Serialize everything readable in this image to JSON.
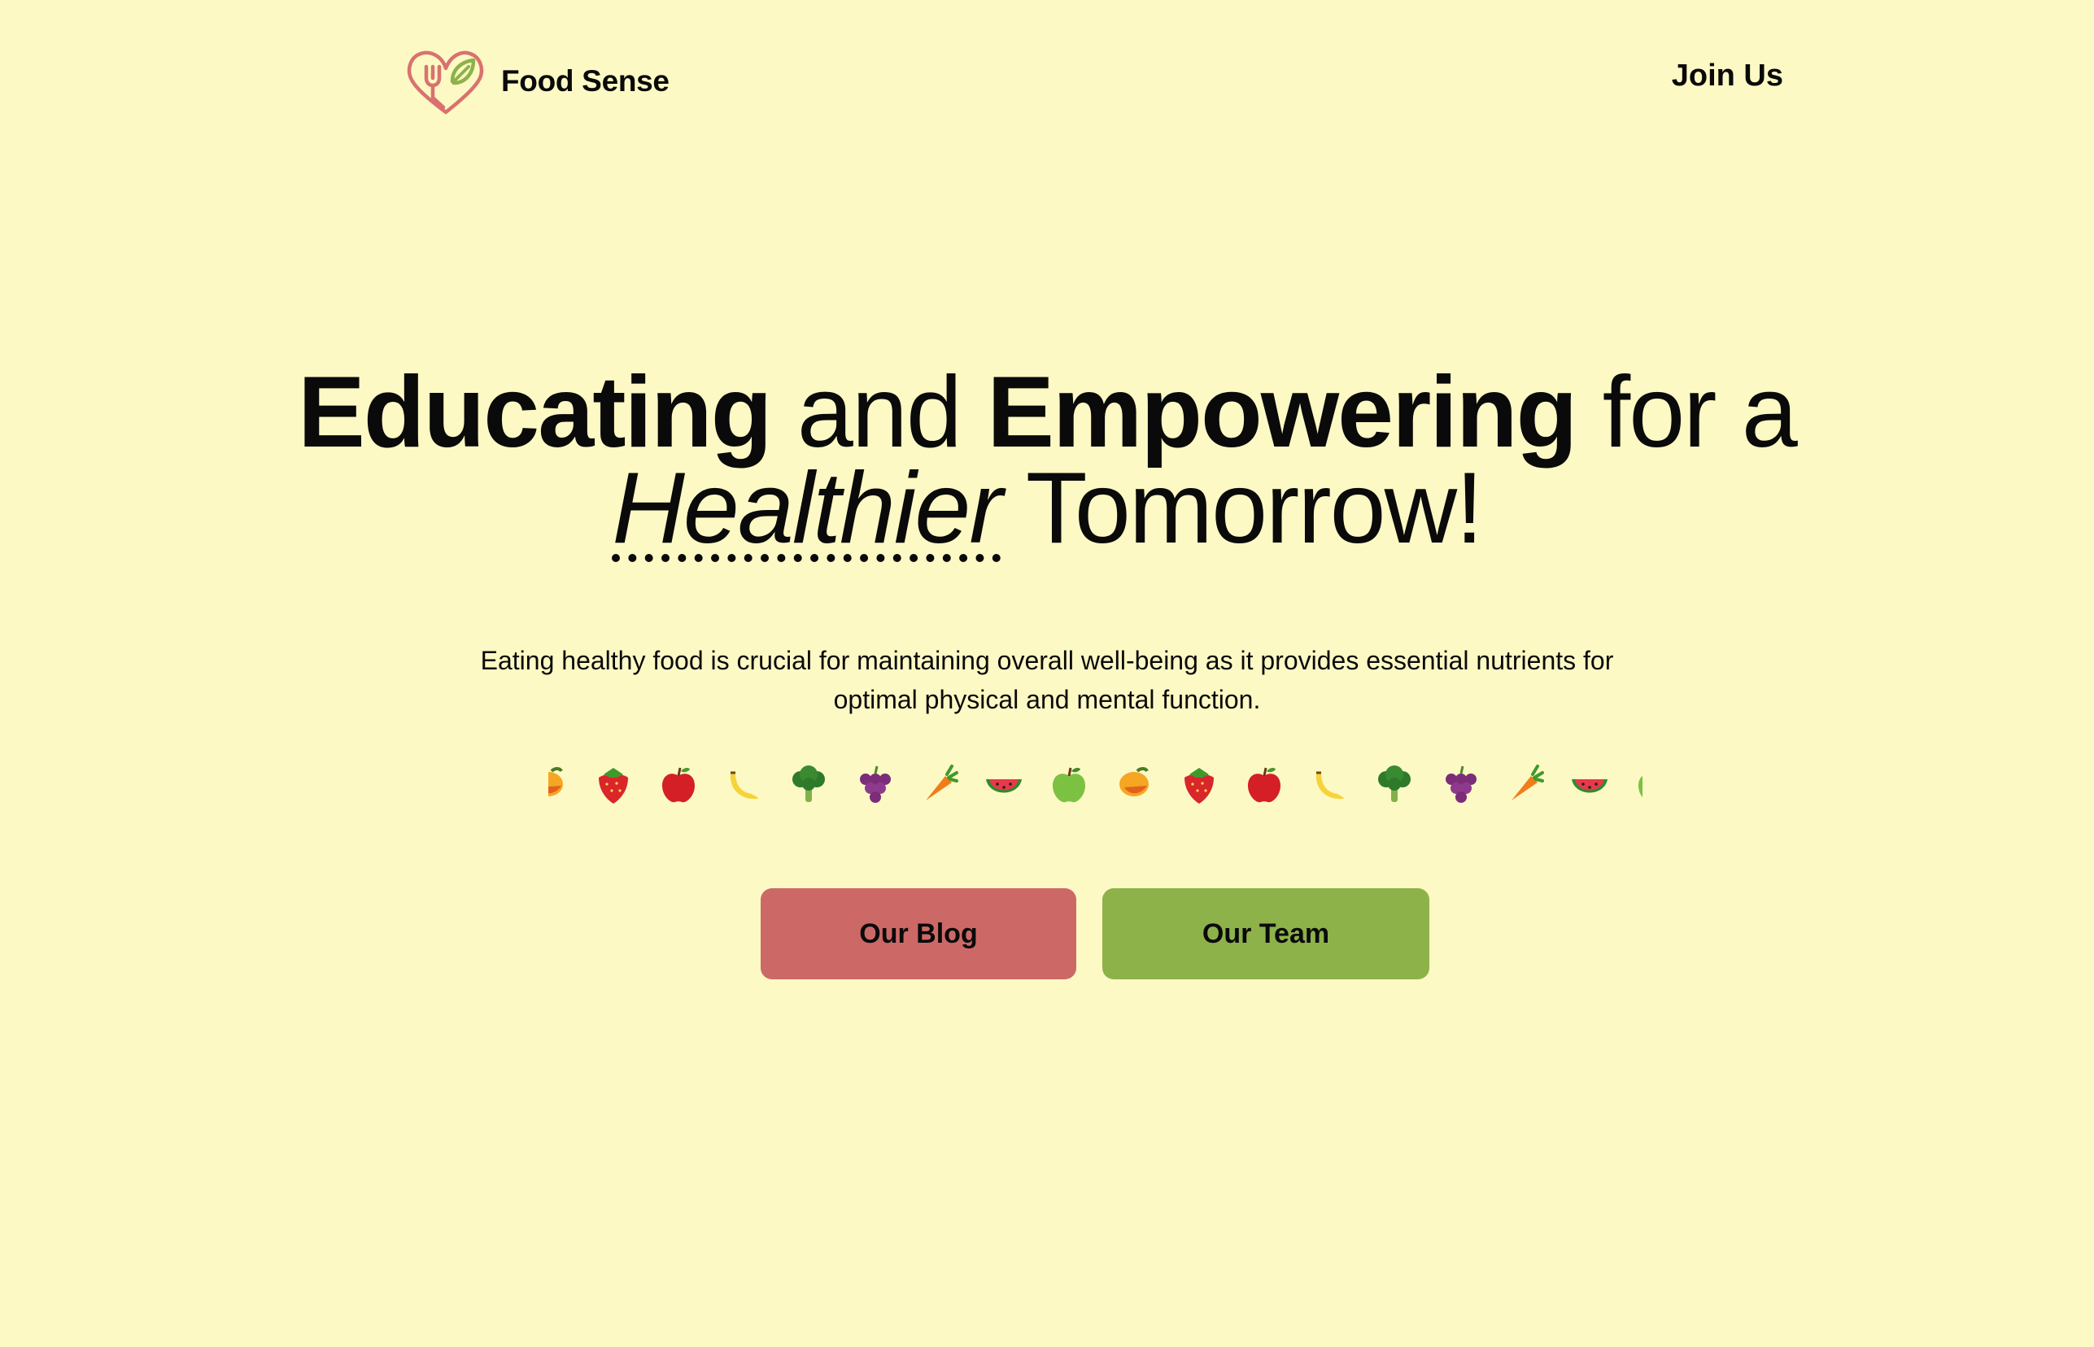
{
  "header": {
    "brand": "Food Sense",
    "logo_icon": "heart-fork-leaf-logo",
    "join_label": "Join Us"
  },
  "hero": {
    "title_word1": "Educating",
    "title_word2": " and ",
    "title_word3": "Empowering",
    "title_word4": " for a",
    "title_word5": "Healthier",
    "title_word6": " Tomorrow!",
    "description": "Eating healthy food is crucial for maintaining overall well-being as it provides essential nutrients for optimal physical and mental function."
  },
  "fruit_strip": {
    "items": [
      "mango",
      "strawberry",
      "red-apple",
      "banana",
      "broccoli",
      "grapes",
      "carrot",
      "watermelon",
      "green-apple",
      "mango",
      "strawberry",
      "red-apple",
      "banana",
      "broccoli",
      "grapes",
      "carrot",
      "watermelon",
      "green-apple"
    ]
  },
  "buttons": {
    "blog_label": "Our Blog",
    "team_label": "Our Team"
  },
  "colors": {
    "background": "#fdf9c4",
    "blog_button": "#cc6966",
    "team_button": "#8db24a",
    "logo_heart": "#d9726f",
    "logo_leaf": "#8db24a"
  }
}
